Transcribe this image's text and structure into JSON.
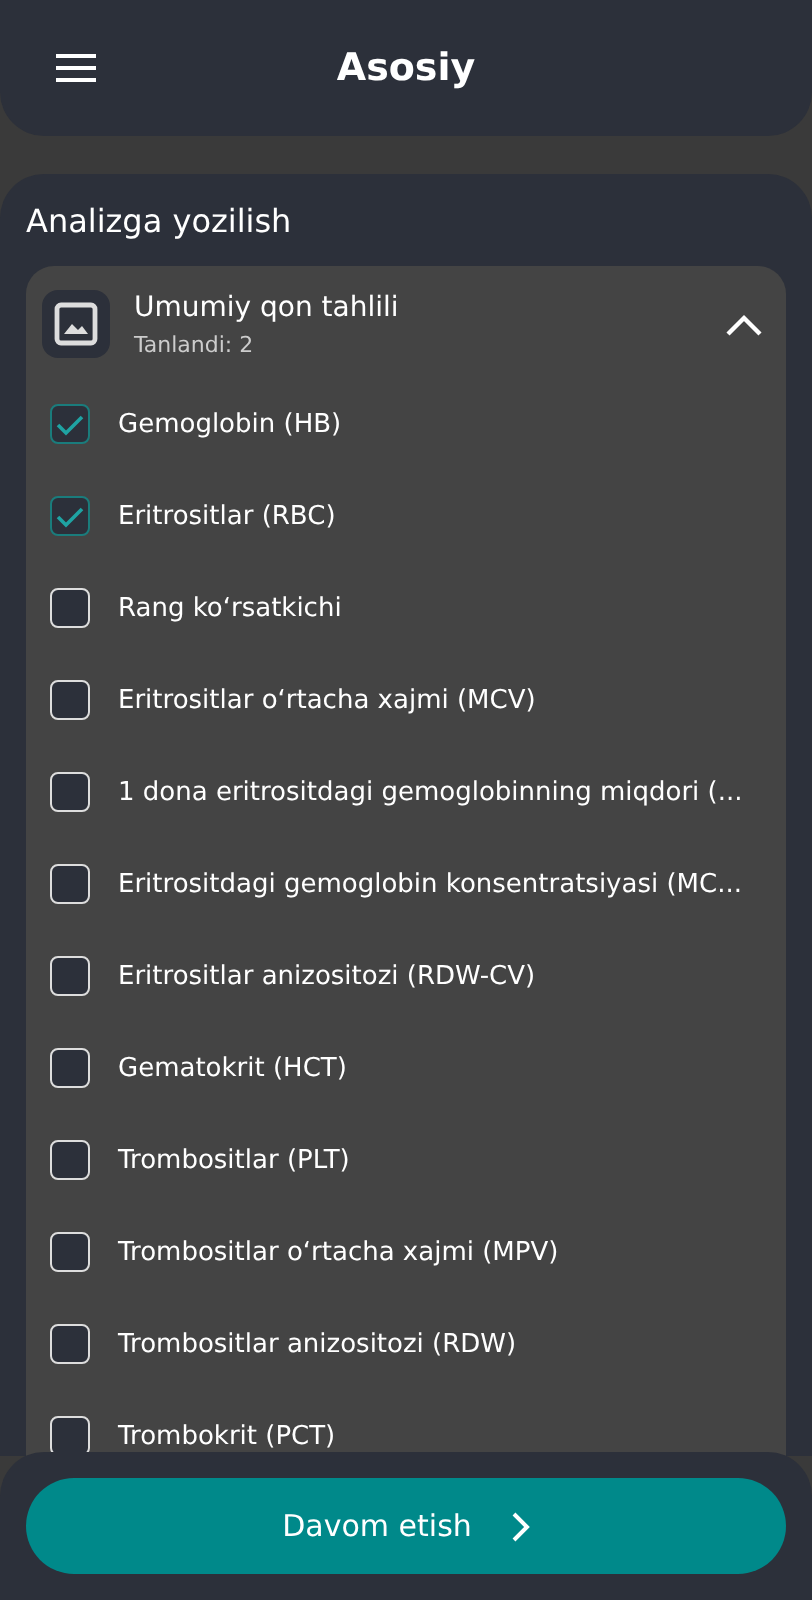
{
  "header": {
    "title": "Asosiy"
  },
  "section": {
    "title": "Analizga yozilish"
  },
  "group": {
    "title": "Umumiy qon tahlili",
    "subtitle": "Tanlandi: 2",
    "expanded": true
  },
  "items": [
    {
      "label": "Gemoglobin (HB)",
      "checked": true
    },
    {
      "label": "Eritrositlar (RBC)",
      "checked": true
    },
    {
      "label": "Rang koʻrsatkichi",
      "checked": false
    },
    {
      "label": "Eritrositlar oʻrtacha xajmi (MCV)",
      "checked": false
    },
    {
      "label": "1 dona eritrositdagi gemoglobinning miqdori (...",
      "checked": false
    },
    {
      "label": "Eritrositdagi gemoglobin konsentratsiyasi (MC...",
      "checked": false
    },
    {
      "label": "Eritrositlar anizositozi (RDW-CV)",
      "checked": false
    },
    {
      "label": "Gematokrit (HCT)",
      "checked": false
    },
    {
      "label": "Trombositlar (PLT)",
      "checked": false
    },
    {
      "label": "Trombositlar oʻrtacha xajmi (MPV)",
      "checked": false
    },
    {
      "label": "Trombositlar anizositozi (RDW)",
      "checked": false
    },
    {
      "label": "Trombokrit (PCT)",
      "checked": false
    }
  ],
  "button": {
    "label": "Davom etish"
  }
}
